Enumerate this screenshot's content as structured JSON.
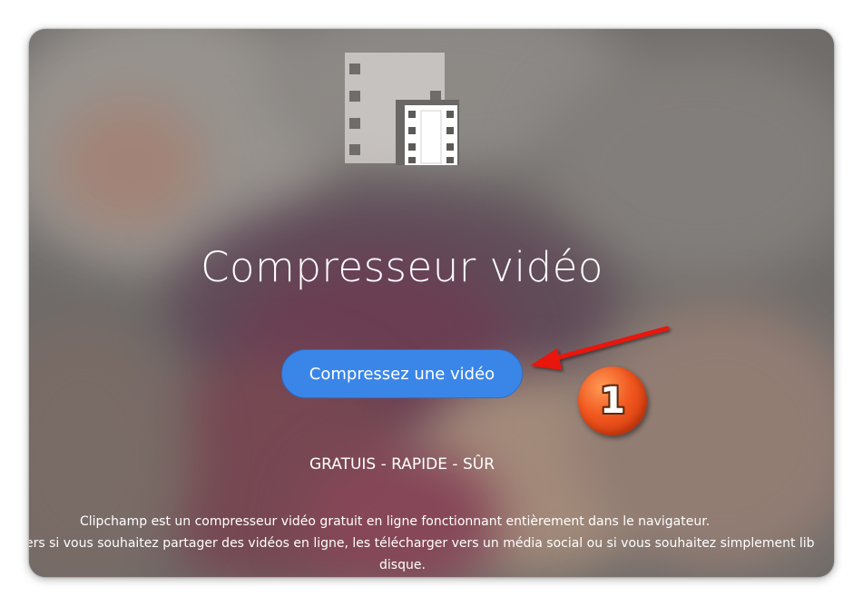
{
  "hero": {
    "icon": "film-compress-icon",
    "title": "Compresseur vidéo",
    "cta_label": "Compressez une vidéo",
    "tagline": "GRATUIS - RAPIDE - SÛR",
    "description_lines": [
      "Clipchamp est un compresseur vidéo gratuit en ligne fonctionnant entièrement dans le navigateur.",
      "ers si vous souhaitez partager des vidéos en ligne, les télécharger vers un média social ou si vous souhaitez simplement lib",
      "disque."
    ]
  },
  "annotation": {
    "step_number": "1",
    "arrow_icon": "red-arrow-icon",
    "badge_color": "#f0561e",
    "arrow_color": "#e8120c"
  },
  "colors": {
    "cta_background": "#3a86e8",
    "text": "#ffffff"
  }
}
